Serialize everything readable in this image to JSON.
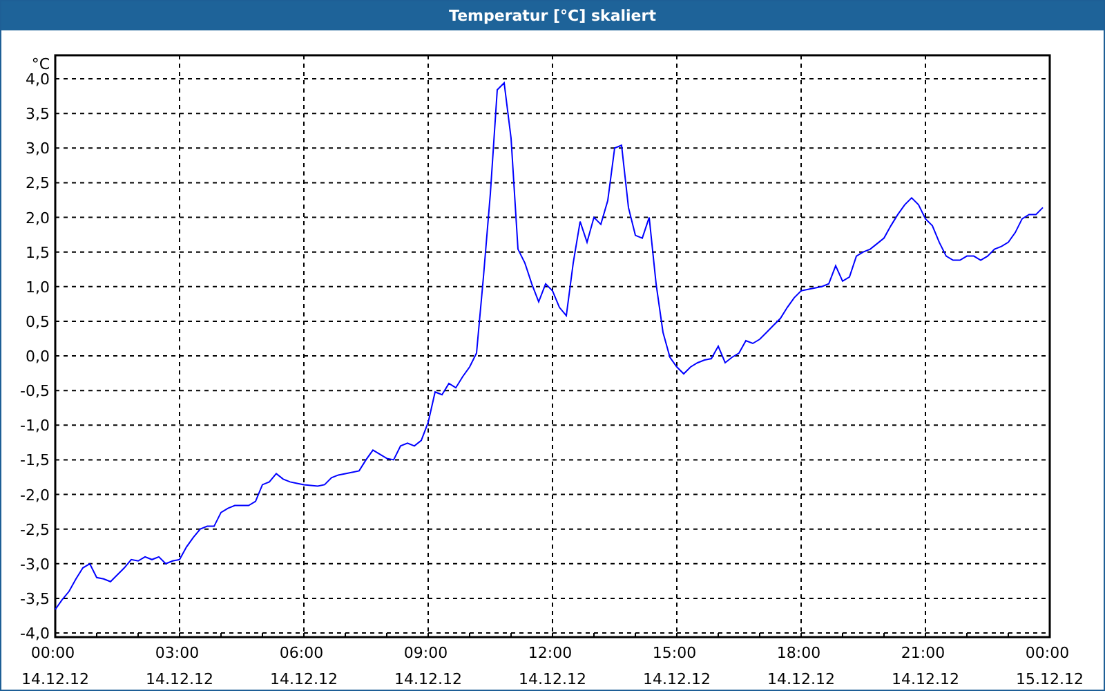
{
  "window": {
    "title": "Temperatur [°C] skaliert"
  },
  "chart_data": {
    "type": "line",
    "ylabel": "°C",
    "ylim": [
      -4,
      4
    ],
    "grid": true,
    "categories": [
      "00:00 14.12.12",
      null,
      null,
      null,
      null,
      null,
      null,
      null,
      null,
      null,
      null,
      null,
      null,
      null,
      null,
      null,
      null,
      null,
      "03:00 14.12.12",
      null,
      null,
      null,
      null,
      null,
      null,
      null,
      null,
      null,
      null,
      null,
      null,
      null,
      null,
      null,
      null,
      null,
      "06:00 14.12.12",
      null,
      null,
      null,
      null,
      null,
      null,
      null,
      null,
      null,
      null,
      null,
      null,
      null,
      null,
      null,
      null,
      null,
      "09:00 14.12.12",
      null,
      null,
      null,
      null,
      null,
      null,
      null,
      null,
      null,
      null,
      null,
      null,
      null,
      null,
      null,
      null,
      null,
      "12:00 14.12.12",
      null,
      null,
      null,
      null,
      null,
      null,
      null,
      null,
      null,
      null,
      null,
      null,
      null,
      null,
      null,
      null,
      null,
      "15:00 14.12.12",
      null,
      null,
      null,
      null,
      null,
      null,
      null,
      null,
      null,
      null,
      null,
      null,
      null,
      null,
      null,
      null,
      null,
      "18:00 14.12.12",
      null,
      null,
      null,
      null,
      null,
      null,
      null,
      null,
      null,
      null,
      null,
      null,
      null,
      null,
      null,
      null,
      null,
      "21:00 14.12.12",
      null,
      null,
      null,
      null,
      null,
      null,
      null,
      null,
      null,
      null,
      null,
      null,
      null,
      null,
      null,
      null,
      null,
      "00:00 15.12.12"
    ],
    "series": [
      {
        "color": "#0000ff",
        "values": [
          -3.66,
          -3.52,
          -3.4,
          -3.22,
          -3.06,
          -3.0,
          -3.2,
          -3.22,
          -3.26,
          -3.16,
          -3.06,
          -2.94,
          -2.96,
          -2.9,
          -2.94,
          -2.9,
          -3.0,
          -2.96,
          -2.94,
          -2.76,
          -2.62,
          -2.5,
          -2.46,
          -2.46,
          -2.26,
          -2.2,
          -2.16,
          -2.16,
          -2.16,
          -2.1,
          -1.86,
          -1.82,
          -1.7,
          -1.78,
          -1.82,
          -1.84,
          -1.86,
          -1.87,
          -1.88,
          -1.86,
          -1.76,
          -1.72,
          -1.7,
          -1.68,
          -1.66,
          -1.5,
          -1.36,
          -1.42,
          -1.48,
          -1.5,
          -1.3,
          -1.26,
          -1.3,
          -1.22,
          -0.96,
          -0.52,
          -0.56,
          -0.4,
          -0.46,
          -0.3,
          -0.16,
          0.04,
          1.14,
          2.34,
          3.84,
          3.94,
          3.14,
          1.54,
          1.34,
          1.04,
          0.78,
          1.04,
          0.94,
          0.7,
          0.58,
          1.34,
          1.94,
          1.64,
          2.0,
          1.9,
          2.24,
          3.0,
          3.04,
          2.14,
          1.74,
          1.7,
          2.0,
          1.04,
          0.34,
          -0.02,
          -0.16,
          -0.26,
          -0.16,
          -0.1,
          -0.06,
          -0.04,
          0.14,
          -0.1,
          -0.02,
          0.04,
          0.22,
          0.18,
          0.24,
          0.34,
          0.44,
          0.54,
          0.7,
          0.84,
          0.94,
          0.96,
          0.98,
          1.0,
          1.04,
          1.3,
          1.08,
          1.14,
          1.44,
          1.5,
          1.54,
          1.62,
          1.7,
          1.88,
          2.04,
          2.18,
          2.28,
          2.18,
          1.98,
          1.88,
          1.64,
          1.44,
          1.38,
          1.38,
          1.44,
          1.44,
          1.38,
          1.44,
          1.54,
          1.58,
          1.64,
          1.78,
          1.98,
          2.04,
          2.04,
          2.14,
          null
        ]
      }
    ],
    "yticks": [
      {
        "value": 4,
        "label": "4,0"
      },
      {
        "value": 3.5,
        "label": "3,5"
      },
      {
        "value": 3,
        "label": "3,0"
      },
      {
        "value": 2.5,
        "label": "2,5"
      },
      {
        "value": 2,
        "label": "2,0"
      },
      {
        "value": 1.5,
        "label": "1,5"
      },
      {
        "value": 1,
        "label": "1,0"
      },
      {
        "value": 0.5,
        "label": "0,5"
      },
      {
        "value": 0,
        "label": "0,0"
      },
      {
        "value": -0.5,
        "label": "-0,5"
      },
      {
        "value": -1,
        "label": "-1,0"
      },
      {
        "value": -1.5,
        "label": "-1,5"
      },
      {
        "value": -2,
        "label": "-2,0"
      },
      {
        "value": -2.5,
        "label": "-2,5"
      },
      {
        "value": -3,
        "label": "-3,0"
      },
      {
        "value": -3.5,
        "label": "-3,5"
      },
      {
        "value": -4,
        "label": "-4,0"
      }
    ]
  }
}
